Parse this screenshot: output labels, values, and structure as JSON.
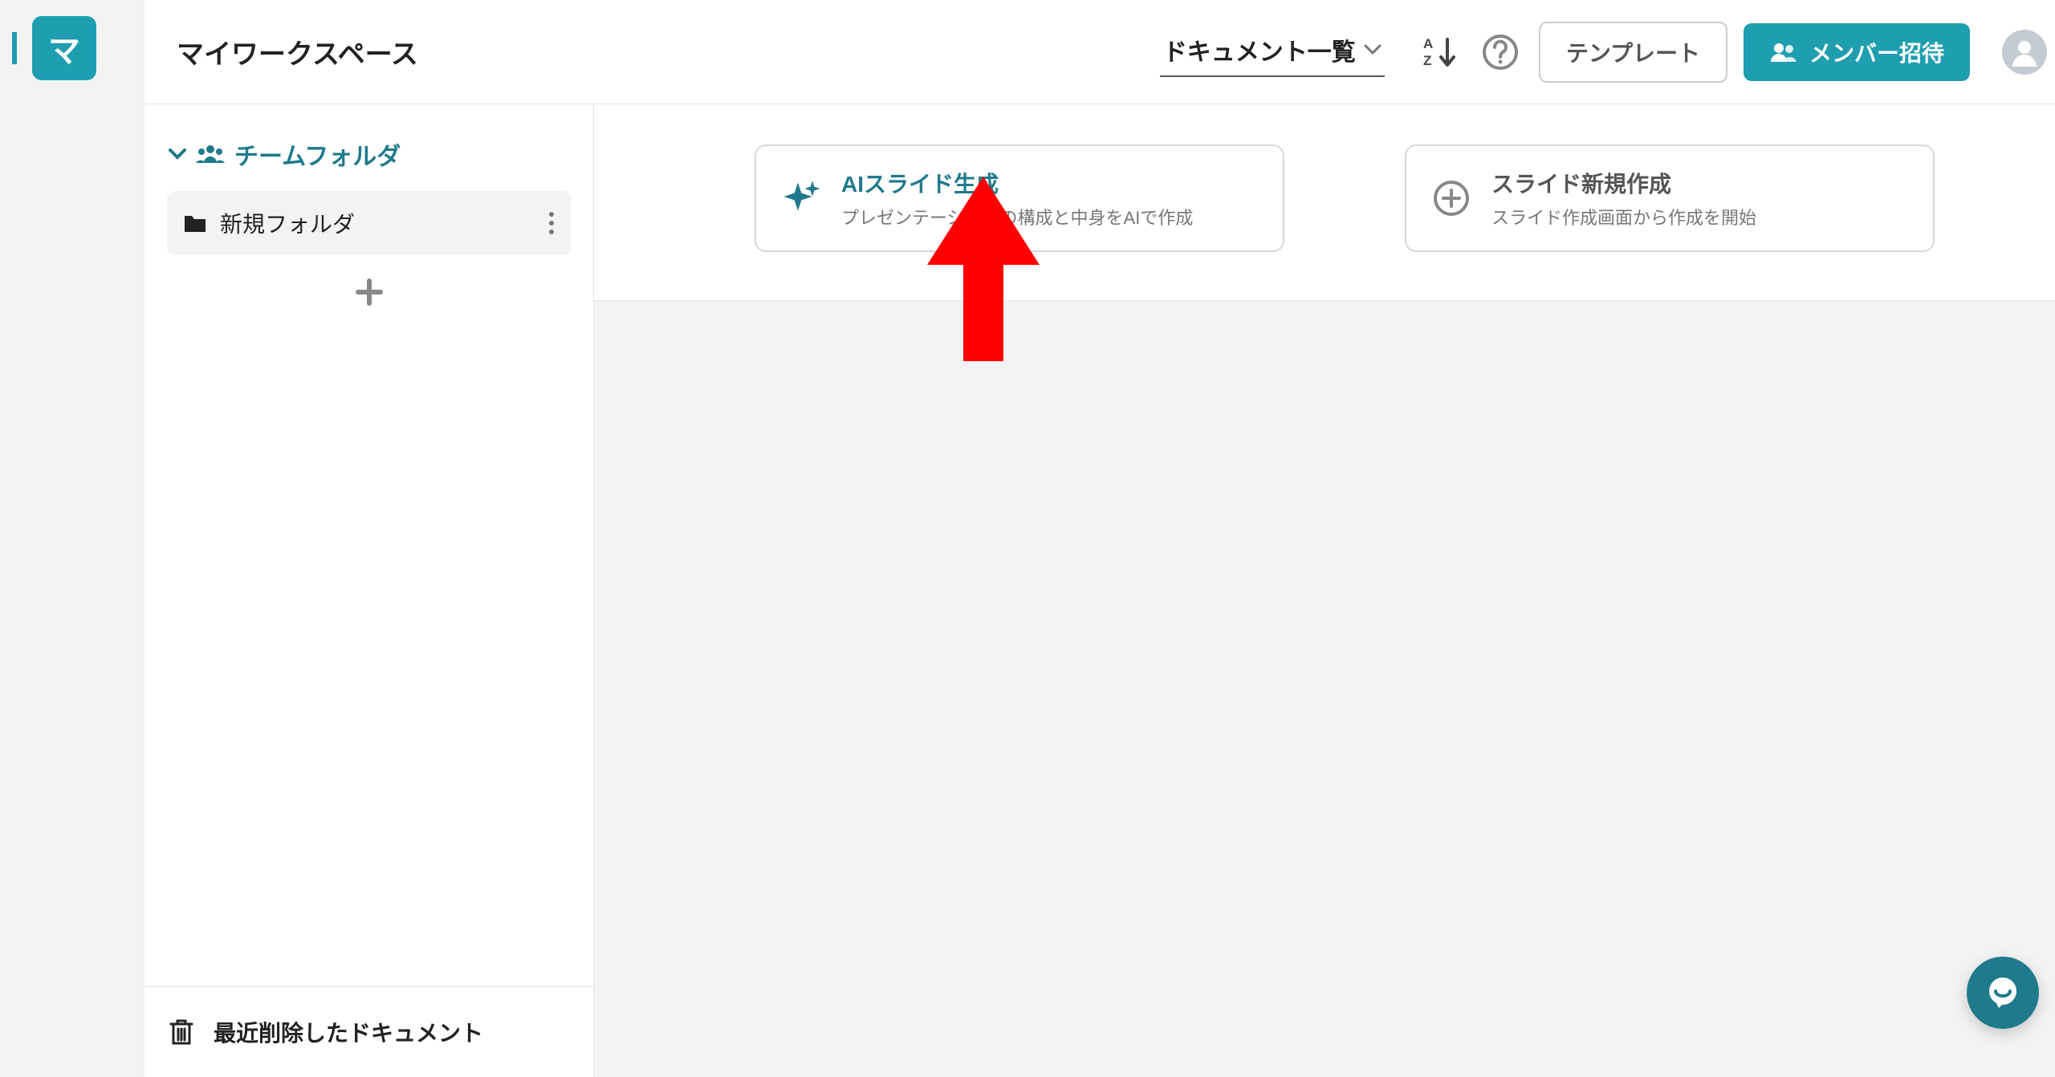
{
  "workspace": {
    "badge_letter": "マ",
    "title": "マイワークスペース"
  },
  "topbar": {
    "view_dropdown_label": "ドキュメント一覧",
    "template_button": "テンプレート",
    "invite_button": "メンバー招待"
  },
  "sidebar": {
    "team_folder_header": "チームフォルダ",
    "folders": [
      {
        "name": "新規フォルダ"
      }
    ],
    "trash_label": "最近削除したドキュメント"
  },
  "cards": {
    "ai": {
      "title": "AIスライド生成",
      "subtitle": "プレゼンテーションの構成と中身をAIで作成"
    },
    "new_slide": {
      "title": "スライド新規作成",
      "subtitle": "スライド作成画面から作成を開始"
    }
  },
  "colors": {
    "accent": "#1f9eb0",
    "accent_dark": "#1f7a8c",
    "annotation": "#ff0000"
  }
}
